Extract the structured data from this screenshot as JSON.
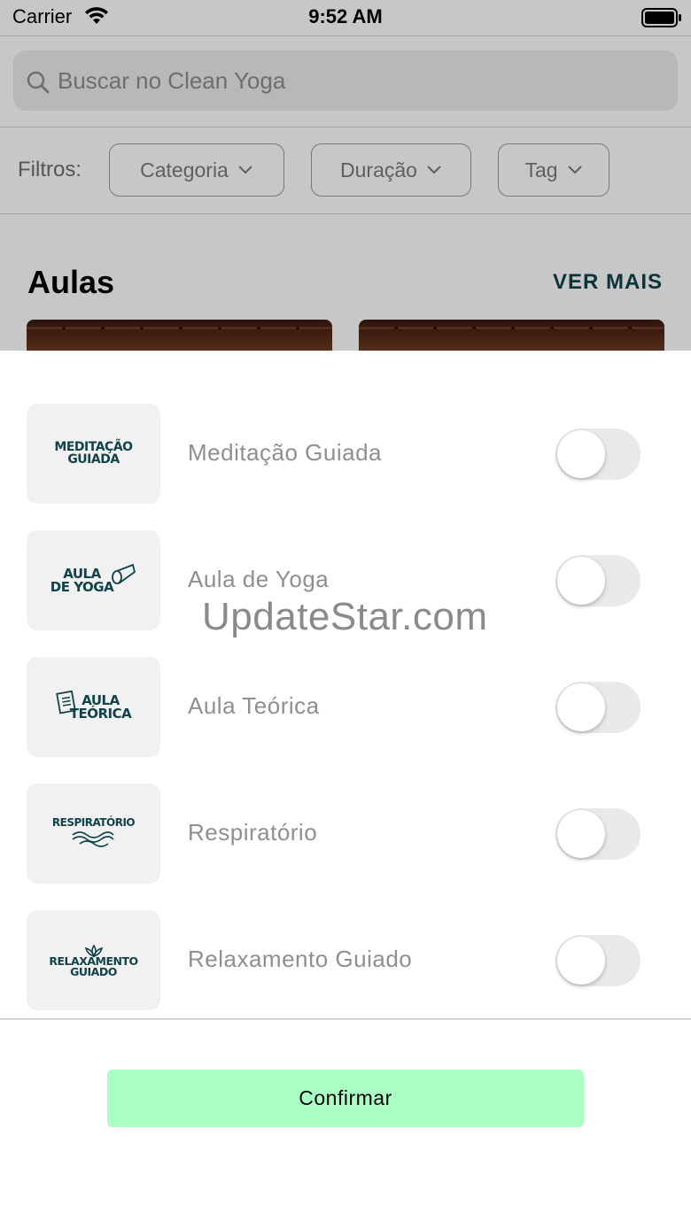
{
  "status_bar": {
    "carrier": "Carrier",
    "time": "9:52 AM"
  },
  "search": {
    "placeholder": "Buscar no Clean Yoga"
  },
  "filters": {
    "label": "Filtros:",
    "chips": [
      {
        "label": "Categoria"
      },
      {
        "label": "Duração"
      },
      {
        "label": "Tag"
      }
    ]
  },
  "section": {
    "title": "Aulas",
    "see_more": "VER MAIS"
  },
  "sheet": {
    "options": [
      {
        "logo": [
          "MEDITAÇÃO",
          "GUIADA"
        ],
        "label": "Meditação Guiada",
        "enabled": false
      },
      {
        "logo": [
          "AULA",
          "DE YOGA"
        ],
        "label": "Aula de Yoga",
        "enabled": false
      },
      {
        "logo": [
          "AULA",
          "TEÓRICA"
        ],
        "label": "Aula Teórica",
        "enabled": false
      },
      {
        "logo": [
          "RESPIRATÓRIO"
        ],
        "label": "Respiratório",
        "enabled": false
      },
      {
        "logo": [
          "RELAXAMENTO",
          "GUIADO"
        ],
        "label": "Relaxamento Guiado",
        "enabled": false
      }
    ],
    "confirm_label": "Confirmar"
  },
  "watermark": "UpdateStar.com",
  "colors": {
    "accent_button": "#aaffc3",
    "brand_teal": "#11434a"
  }
}
